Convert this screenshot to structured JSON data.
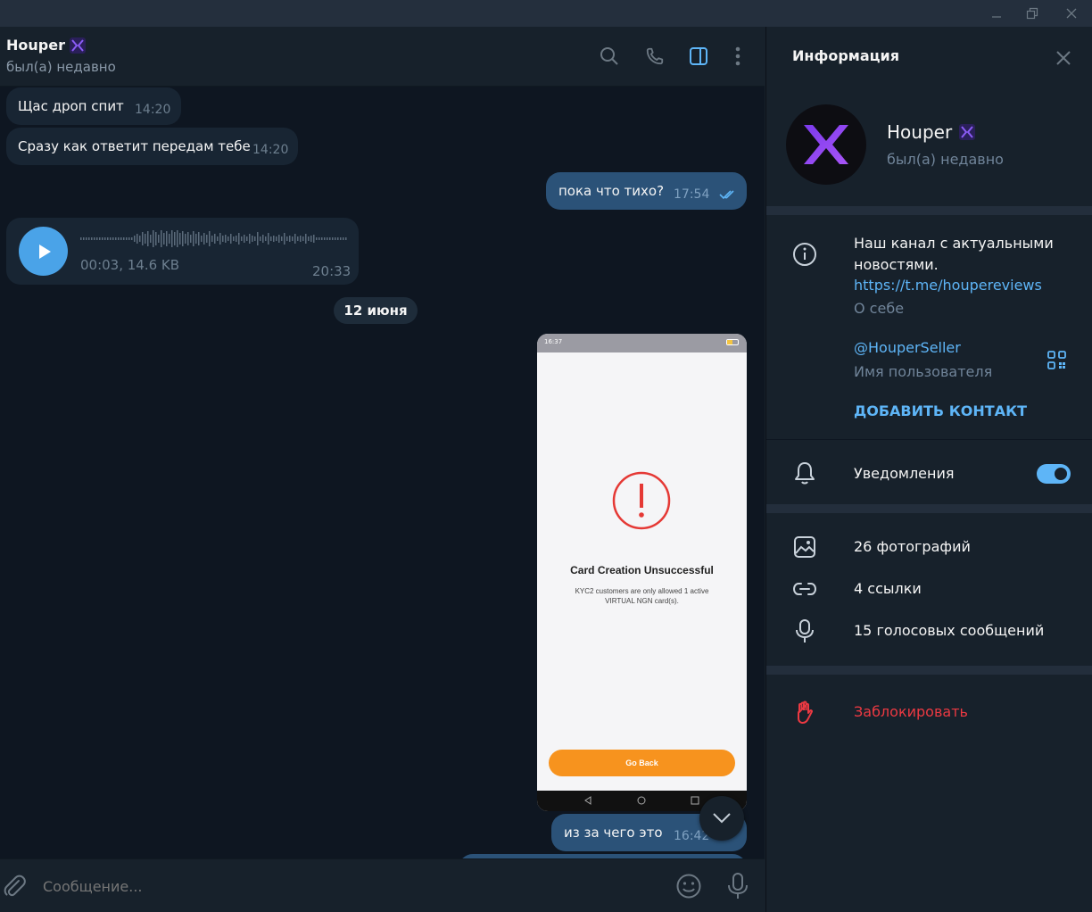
{
  "header": {
    "name": "Houper",
    "status": "был(а) недавно"
  },
  "messages": {
    "m1": {
      "text": "Щас дроп спит",
      "time": "14:20"
    },
    "m2": {
      "text": "Сразу как ответит передам тебе",
      "time": "14:20"
    },
    "m3": {
      "text": "пока что тихо?",
      "time": "17:54"
    },
    "voice": {
      "meta": "00:03, 14.6 KB",
      "time": "20:33"
    },
    "date_divider": "12 июня",
    "m4": {
      "text": "из за чего это",
      "time": "16:42"
    }
  },
  "screenshot": {
    "status_time": "16:37",
    "title": "Card Creation Unsuccessful",
    "body": "KYC2 customers are only allowed 1 active VIRTUAL NGN card(s).",
    "button": "Go Back"
  },
  "composer": {
    "placeholder": "Сообщение..."
  },
  "panel": {
    "title": "Информация",
    "name": "Houper",
    "status": "был(а) недавно",
    "bio": "Наш канал с актуальными новостями.",
    "bio_link": "https://t.me/houpereviews",
    "bio_caption": "О себе",
    "username": "@HouperSeller",
    "username_caption": "Имя пользователя",
    "add_contact": "ДОБАВИТЬ КОНТАКТ",
    "notifications": "Уведомления",
    "notifications_on": true,
    "photos": "26 фотографий",
    "links": "4 ссылки",
    "voices": "15 голосовых сообщений",
    "block": "Заблокировать"
  },
  "colors": {
    "accent": "#5eb5f7",
    "outgoing_bubble": "#2b5278",
    "incoming_bubble": "#182533",
    "danger": "#ec3942",
    "warning_orange": "#f7931e"
  }
}
